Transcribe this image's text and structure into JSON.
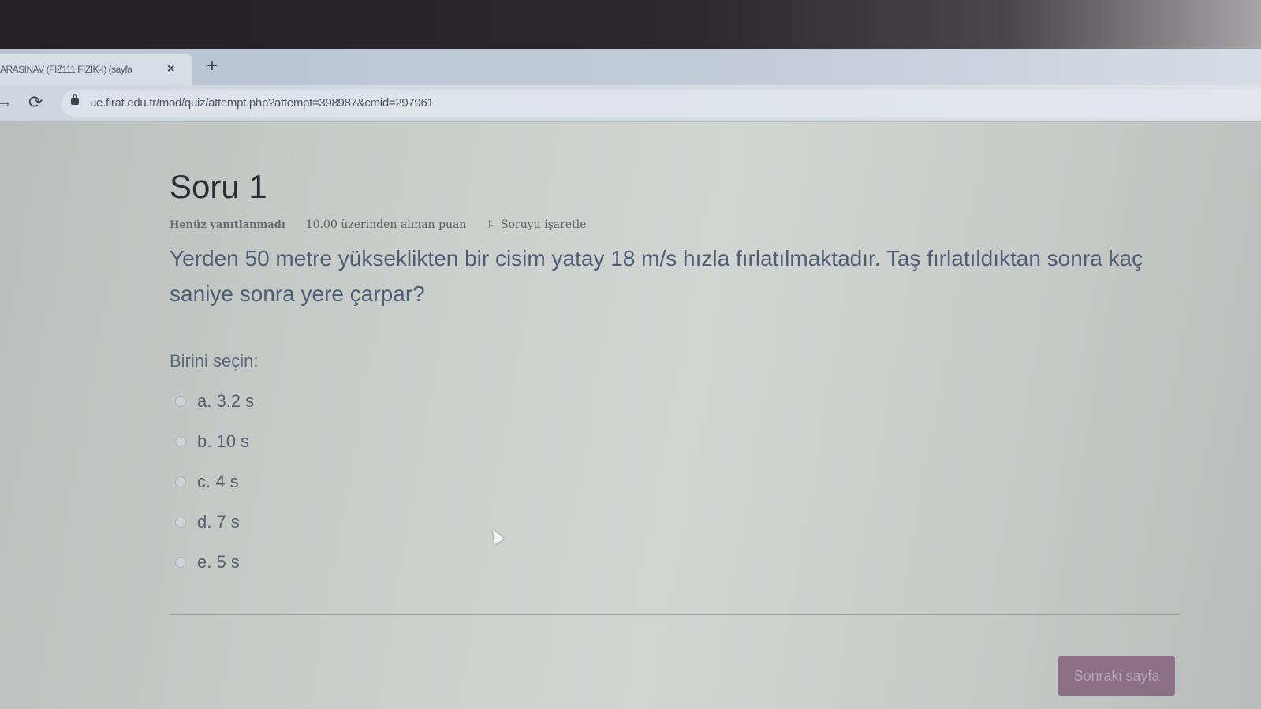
{
  "browser": {
    "tab": {
      "title": "ARASINAV (FIZ111 FIZIK-I) (sayfa",
      "close_icon": "×"
    },
    "new_tab_icon": "+",
    "nav": {
      "forward_icon": "→",
      "reload_icon": "⟳"
    },
    "url": "ue.firat.edu.tr/mod/quiz/attempt.php?attempt=398987&cmid=297961"
  },
  "question": {
    "title": "Soru 1",
    "status": "Henüz yanıtlanmadı",
    "points": "10.00 üzerinden alınan puan",
    "flag_label": "Soruyu işaretle",
    "text": "Yerden 50 metre yükseklikten bir cisim yatay 18 m/s hızla fırlatılmaktadır. Taş fırlatıldıktan sonra kaç saniye sonra yere çarpar?",
    "prompt": "Birini seçin:",
    "answers": [
      {
        "label": "a. 3.2 s"
      },
      {
        "label": "b. 10 s"
      },
      {
        "label": "c. 4 s"
      },
      {
        "label": "d. 7 s"
      },
      {
        "label": "e. 5 s"
      }
    ]
  },
  "footer": {
    "next_label": "Sonraki sayfa"
  },
  "colors": {
    "accent_button": "#8c6f85",
    "question_text": "#4e5d73"
  }
}
